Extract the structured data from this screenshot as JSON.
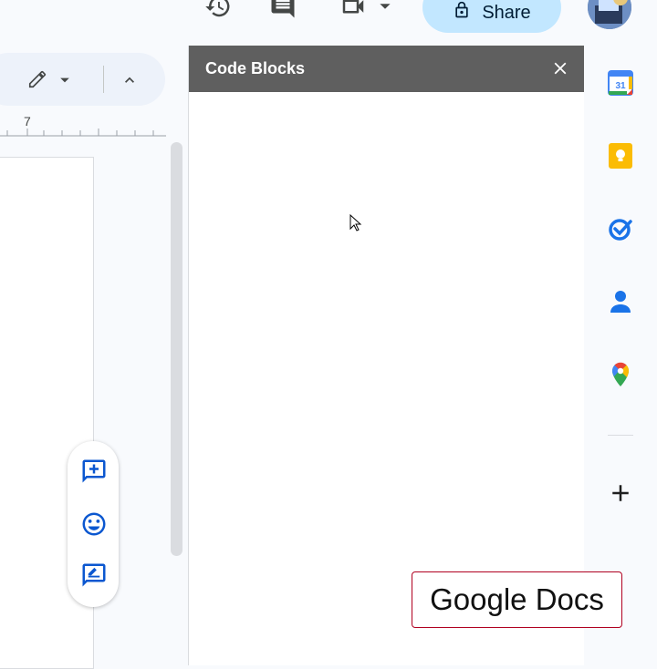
{
  "toolbar": {
    "share_label": "Share",
    "icons": [
      "version-history-icon",
      "comments-icon",
      "meet-video-icon",
      "dropdown-icon",
      "lock-icon"
    ]
  },
  "ruler": {
    "mark_label": "7"
  },
  "panel": {
    "title": "Code Blocks"
  },
  "watermark": {
    "text": "Google Docs"
  },
  "colors": {
    "panel_header": "#5f5f5f",
    "share_bg": "#c2e7ff",
    "accent_blue": "#1a73e8",
    "watermark_border": "#b00020"
  }
}
